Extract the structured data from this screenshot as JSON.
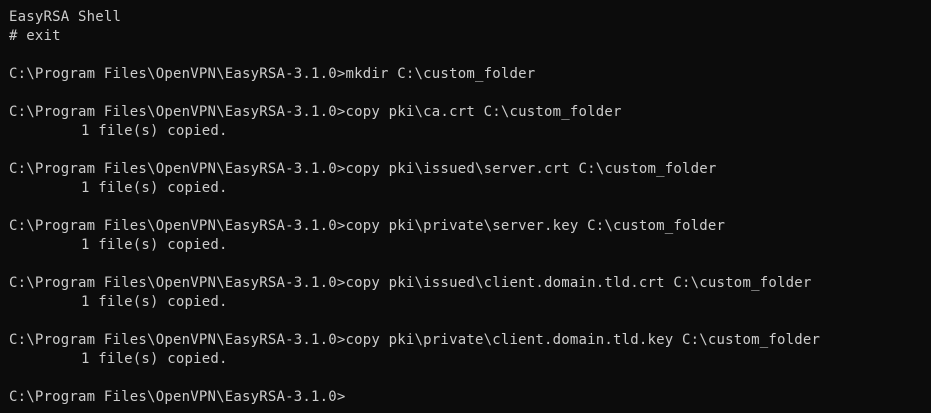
{
  "terminal": {
    "title_line": "EasyRSA Shell",
    "lines": [
      {
        "type": "text",
        "text": "# exit"
      },
      {
        "type": "blank"
      },
      {
        "type": "cmd",
        "text": "C:\\Program Files\\OpenVPN\\EasyRSA-3.1.0>mkdir C:\\custom_folder"
      },
      {
        "type": "blank"
      },
      {
        "type": "cmd",
        "text": "C:\\Program Files\\OpenVPN\\EasyRSA-3.1.0>copy pki\\ca.crt C:\\custom_folder"
      },
      {
        "type": "out",
        "text": "1 file(s) copied."
      },
      {
        "type": "blank"
      },
      {
        "type": "cmd",
        "text": "C:\\Program Files\\OpenVPN\\EasyRSA-3.1.0>copy pki\\issued\\server.crt C:\\custom_folder"
      },
      {
        "type": "out",
        "text": "1 file(s) copied."
      },
      {
        "type": "blank"
      },
      {
        "type": "cmd",
        "text": "C:\\Program Files\\OpenVPN\\EasyRSA-3.1.0>copy pki\\private\\server.key C:\\custom_folder"
      },
      {
        "type": "out",
        "text": "1 file(s) copied."
      },
      {
        "type": "blank"
      },
      {
        "type": "cmd",
        "text": "C:\\Program Files\\OpenVPN\\EasyRSA-3.1.0>copy pki\\issued\\client.domain.tld.crt C:\\custom_folder"
      },
      {
        "type": "out",
        "text": "1 file(s) copied."
      },
      {
        "type": "blank"
      },
      {
        "type": "cmd",
        "text": "C:\\Program Files\\OpenVPN\\EasyRSA-3.1.0>copy pki\\private\\client.domain.tld.key C:\\custom_folder"
      },
      {
        "type": "out",
        "text": "1 file(s) copied."
      },
      {
        "type": "blank"
      },
      {
        "type": "prompt",
        "text": "C:\\Program Files\\OpenVPN\\EasyRSA-3.1.0>"
      }
    ]
  },
  "colors": {
    "background": "#0c0c0c",
    "foreground": "#cccccc"
  }
}
